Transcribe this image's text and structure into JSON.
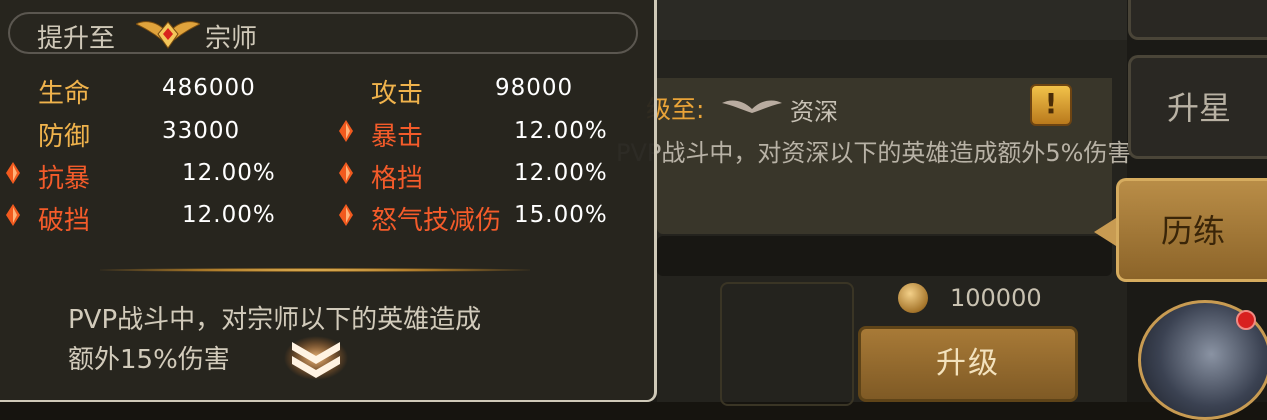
{
  "background": {
    "rank_up_prefix": "级至:",
    "rank_up_name": "资深",
    "rank_desc": "PVP战斗中，对资深以下的英雄造成额外5%伤害",
    "coin_cost": "100000",
    "upgrade_button": "升级",
    "side_tabs": [
      {
        "label": ""
      },
      {
        "label": "升星"
      },
      {
        "label": "历练"
      }
    ],
    "exclaim": "!"
  },
  "tooltip": {
    "header_prefix": "提升至",
    "rank_name": "宗师",
    "rank_icon": "winged-crest-icon",
    "stats": [
      {
        "label": "生命",
        "value": "486000",
        "color": "#f0b34c",
        "marked": false
      },
      {
        "label": "攻击",
        "value": "98000",
        "color": "#f0b34c",
        "marked": false
      },
      {
        "label": "防御",
        "value": "33000",
        "color": "#f0b34c",
        "marked": false
      },
      {
        "label": "暴击",
        "value": "12.00%",
        "color": "#f45b2a",
        "marked": true
      },
      {
        "label": "抗暴",
        "value": "12.00%",
        "color": "#f45b2a",
        "marked": true
      },
      {
        "label": "格挡",
        "value": "12.00%",
        "color": "#f45b2a",
        "marked": true
      },
      {
        "label": "破挡",
        "value": "12.00%",
        "color": "#f45b2a",
        "marked": true
      },
      {
        "label": "怒气技减伤",
        "value": "15.00%",
        "color": "#f45b2a",
        "marked": true
      }
    ],
    "description": "PVP战斗中，对宗师以下的英雄造成额外15%伤害",
    "description_line1": "PVP战斗中，对宗师以下的英雄造成",
    "description_line2": "额外15%伤害",
    "expand_icon": "chevron-double-down-icon"
  }
}
